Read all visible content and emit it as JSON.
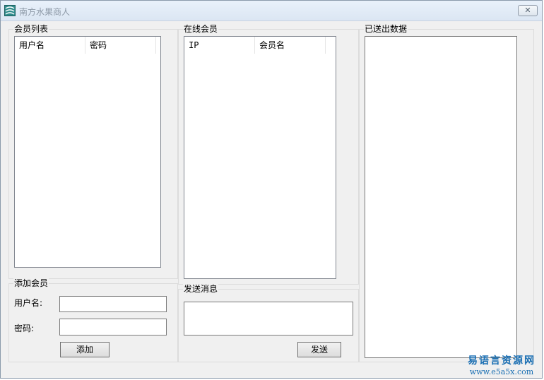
{
  "window": {
    "title": "南方水果商人",
    "close_glyph": "✕"
  },
  "members": {
    "group_title": "会员列表",
    "columns": [
      "用户名",
      "密码"
    ]
  },
  "online": {
    "group_title": "在线会员",
    "columns": [
      "IP",
      "会员名"
    ]
  },
  "sent": {
    "group_title": "已送出数据"
  },
  "add_member": {
    "group_title": "添加会员",
    "username_label": "用户名:",
    "username_value": "",
    "password_label": "密码:",
    "password_value": "",
    "add_button": "添加"
  },
  "send_message": {
    "group_title": "发送消息",
    "message_value": "",
    "send_button": "发送"
  },
  "watermark": {
    "text": "易语言资源网",
    "url": "www.e5a5x.com"
  }
}
